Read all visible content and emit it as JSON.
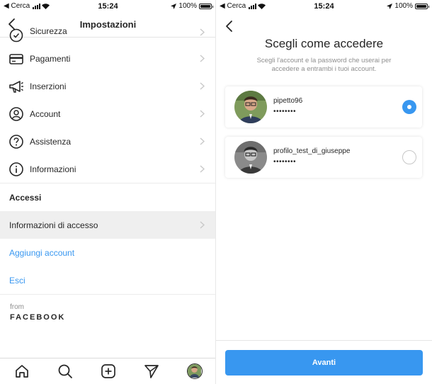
{
  "left": {
    "statusbar": {
      "carrier": "◀ Cerca",
      "time": "15:24",
      "battery": "100%"
    },
    "header": {
      "title": "Impostazioni"
    },
    "menu": [
      {
        "label": "Sicurezza",
        "icon": "shield-check-icon"
      },
      {
        "label": "Pagamenti",
        "icon": "credit-card-icon"
      },
      {
        "label": "Inserzioni",
        "icon": "megaphone-icon"
      },
      {
        "label": "Account",
        "icon": "account-circle-icon"
      },
      {
        "label": "Assistenza",
        "icon": "help-icon"
      },
      {
        "label": "Informazioni",
        "icon": "info-icon"
      }
    ],
    "section_title": "Accessi",
    "login_info": "Informazioni di accesso",
    "add_account": "Aggiungi account",
    "logout": "Esci",
    "from_label": "from",
    "from_brand": "FACEBOOK",
    "tabs": [
      "home-icon",
      "search-icon",
      "add-post-icon",
      "direct-icon",
      "profile-avatar"
    ]
  },
  "right": {
    "statusbar": {
      "carrier": "◀ Cerca",
      "time": "15:24",
      "battery": "100%"
    },
    "title": "Scegli come accedere",
    "subtitle": "Scegli l'account e la password che userai per accedere a entrambi i tuoi account.",
    "accounts": [
      {
        "username": "pipetto96",
        "password": "••••••••",
        "selected": true
      },
      {
        "username": "profilo_test_di_giuseppe",
        "password": "••••••••",
        "selected": false
      }
    ],
    "next_button": "Avanti"
  },
  "colors": {
    "accent": "#3897f0",
    "text": "#262626",
    "muted": "#8e8e8e"
  }
}
